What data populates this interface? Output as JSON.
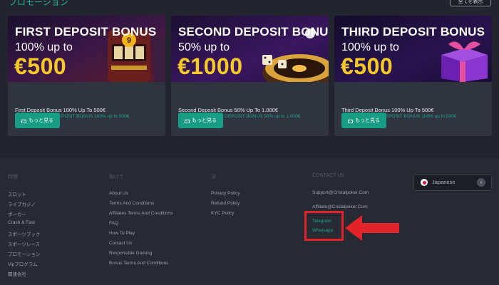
{
  "promotions": {
    "title": "プロモーション",
    "view_all": "全てを表示",
    "cards": [
      {
        "banner_line1": "FIRST DEPOSIT BONUS",
        "banner_line2": "100% up to",
        "banner_line3": "€500",
        "title": "First Deposit Bonus 100% Up To 500€",
        "subtitle": "GET YOUR FIRST DEPOSIT BONUS 100% up to 500€",
        "button": "もっと見る"
      },
      {
        "banner_line1": "SECOND DEPOSIT BONUS",
        "banner_line2": "50% up to",
        "banner_line3": "€1000",
        "title": "Second Deposit Bonus 50% Up To 1.000€",
        "subtitle": "GET YOUR SECOND DEPOSIT BONUS 50% up to 1.000€",
        "button": "もっと見る"
      },
      {
        "banner_line1": "THIRD DEPOSIT BONUS",
        "banner_line2": "100% up to",
        "banner_line3": "€500",
        "title": "Third Deposit Bonus 100% Up To 500€",
        "subtitle": "GET YOUR THIRD DEPOSIT BONUS 100% up to 500€",
        "button": "もっと見る"
      }
    ]
  },
  "footer": {
    "col1": {
      "heading": "特徴",
      "links": [
        "スロット",
        "ライブカジノ",
        "ポーカー",
        "Crash & Fast",
        "スポーツブック",
        "スポーツレース",
        "プロモーション",
        "Vipプログラム",
        "関連会社"
      ]
    },
    "col2": {
      "heading": "助けて",
      "links": [
        "About Us",
        "Terms And Conditions",
        "Affiliates Terms And Conditions",
        "FAQ",
        "How To Play",
        "Contact Us",
        "Responsible Gaming",
        "Bonus Terms And Conditions"
      ]
    },
    "col3": {
      "heading": "法",
      "links": [
        "Privacy Policy",
        "Refund Policy",
        "KYC Policy"
      ]
    },
    "contact": {
      "heading": "CONTACT US",
      "support_email": "Support@Cristalpoker.Com",
      "affiliate_email": "Affiliate@Cristalpoker.Com",
      "telegram": "Telegram",
      "whatsapp": "Whatsapp"
    },
    "language": {
      "selected": "Japanese",
      "flag_icon": "japan-flag-icon",
      "chevron_icon": "chevron-left-icon"
    }
  },
  "colors": {
    "accent": "#179c85",
    "highlight": "#e2232a",
    "bonus_amount": "#f7c928"
  }
}
